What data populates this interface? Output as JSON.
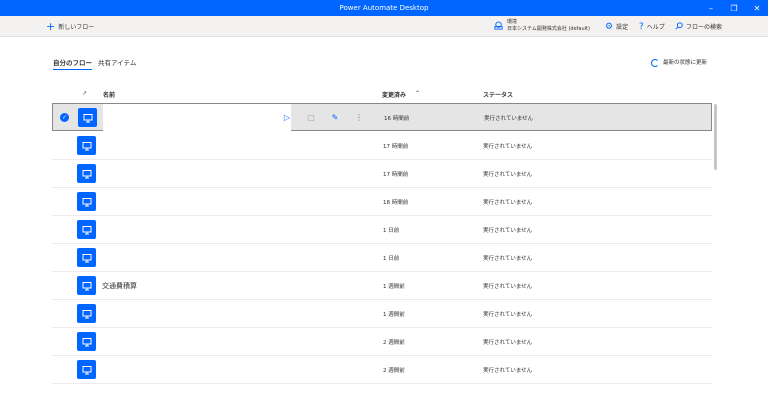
{
  "window": {
    "title": "Power Automate Desktop"
  },
  "toolbar": {
    "new_flow_label": "新しいフロー",
    "environment_label": "環境",
    "environment_name": "日本システム開発株式会社 (default)",
    "settings_label": "設定",
    "help_label": "ヘルプ",
    "search_label": "フローの検索"
  },
  "tabs": [
    {
      "label": "自分のフロー",
      "active": true
    },
    {
      "label": "共有アイテム",
      "active": false
    }
  ],
  "refresh_label": "最新の状態に更新",
  "table": {
    "columns": {
      "name": "名前",
      "modified": "変更済み",
      "status": "ステータス"
    },
    "rows": [
      {
        "name": "",
        "modified": "16 時間前",
        "status": "実行されていません",
        "selected": true
      },
      {
        "name": "",
        "modified": "17 時間前",
        "status": "実行されていません"
      },
      {
        "name": "",
        "modified": "17 時間前",
        "status": "実行されていません"
      },
      {
        "name": "",
        "modified": "18 時間前",
        "status": "実行されていません"
      },
      {
        "name": "",
        "modified": "1 日前",
        "status": "実行されていません"
      },
      {
        "name": "",
        "modified": "1 日前",
        "status": "実行されていません"
      },
      {
        "name": "交通費積算",
        "modified": "1 週間前",
        "status": "実行されていません"
      },
      {
        "name": "",
        "modified": "1 週間前",
        "status": "実行されていません"
      },
      {
        "name": "",
        "modified": "2 週間前",
        "status": "実行されていません"
      },
      {
        "name": "",
        "modified": "2 週間前",
        "status": "実行されていません"
      }
    ]
  },
  "colors": {
    "accent": "#0066ff",
    "titlebar": "#0066ff",
    "commandbar": "#f3f2f1",
    "selected_row": "#e5e5e5"
  }
}
